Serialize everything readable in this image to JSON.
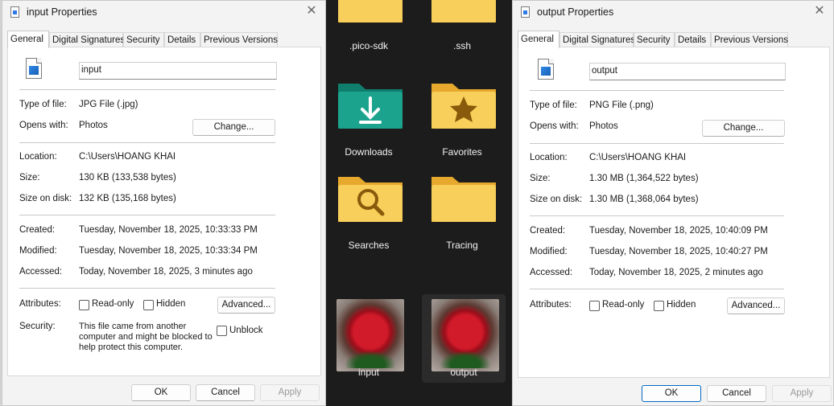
{
  "explorer": {
    "folders": [
      {
        "name": ".pico-sdk",
        "kind": "folder"
      },
      {
        "name": ".ssh",
        "kind": "folder"
      },
      {
        "name": "Downloads",
        "kind": "downloads-folder"
      },
      {
        "name": "Favorites",
        "kind": "favorites-folder"
      },
      {
        "name": "Searches",
        "kind": "searches-folder"
      },
      {
        "name": "Tracing",
        "kind": "folder"
      },
      {
        "name": "input",
        "kind": "image"
      },
      {
        "name": "output",
        "kind": "image"
      }
    ]
  },
  "input_dialog": {
    "title": "input Properties",
    "tabs": [
      "General",
      "Digital Signatures",
      "Security",
      "Details",
      "Previous Versions"
    ],
    "filename": "input",
    "type_label": "Type of file:",
    "type_value": "JPG File (.jpg)",
    "opens_label": "Opens with:",
    "opens_value": "Photos",
    "change_label": "Change...",
    "location_label": "Location:",
    "location_value": "C:\\Users\\HOANG KHAI",
    "size_label": "Size:",
    "size_value": "130 KB (133,538 bytes)",
    "disk_label": "Size on disk:",
    "disk_value": "132 KB (135,168 bytes)",
    "created_label": "Created:",
    "created_value": "Tuesday, November 18, 2025, 10:33:33 PM",
    "modified_label": "Modified:",
    "modified_value": "Tuesday, November 18, 2025, 10:33:34 PM",
    "accessed_label": "Accessed:",
    "accessed_value": "Today, November 18, 2025, 3 minutes ago",
    "attributes_label": "Attributes:",
    "readonly_label": "Read-only",
    "hidden_label": "Hidden",
    "advanced_label": "Advanced...",
    "security_label": "Security:",
    "security_lines": [
      "This file came from another",
      "computer and might be blocked to",
      "help protect this computer."
    ],
    "unblock_label": "Unblock",
    "ok_label": "OK",
    "cancel_label": "Cancel",
    "apply_label": "Apply"
  },
  "output_dialog": {
    "title": "output Properties",
    "tabs": [
      "General",
      "Digital Signatures",
      "Security",
      "Details",
      "Previous Versions"
    ],
    "filename": "output",
    "type_label": "Type of file:",
    "type_value": "PNG File (.png)",
    "opens_label": "Opens with:",
    "opens_value": "Photos",
    "change_label": "Change...",
    "location_label": "Location:",
    "location_value": "C:\\Users\\HOANG KHAI",
    "size_label": "Size:",
    "size_value": "1.30 MB (1,364,522 bytes)",
    "disk_label": "Size on disk:",
    "disk_value": "1.30 MB (1,368,064 bytes)",
    "created_label": "Created:",
    "created_value": "Tuesday, November 18, 2025, 10:40:09 PM",
    "modified_label": "Modified:",
    "modified_value": "Tuesday, November 18, 2025, 10:40:27 PM",
    "accessed_label": "Accessed:",
    "accessed_value": "Today, November 18, 2025, 2 minutes ago",
    "attributes_label": "Attributes:",
    "readonly_label": "Read-only",
    "hidden_label": "Hidden",
    "advanced_label": "Advanced...",
    "ok_label": "OK",
    "cancel_label": "Cancel",
    "apply_label": "Apply"
  },
  "colors": {
    "accent": "#0067c0",
    "folder": "#f6c84c",
    "downloads": "#1ca38e"
  }
}
